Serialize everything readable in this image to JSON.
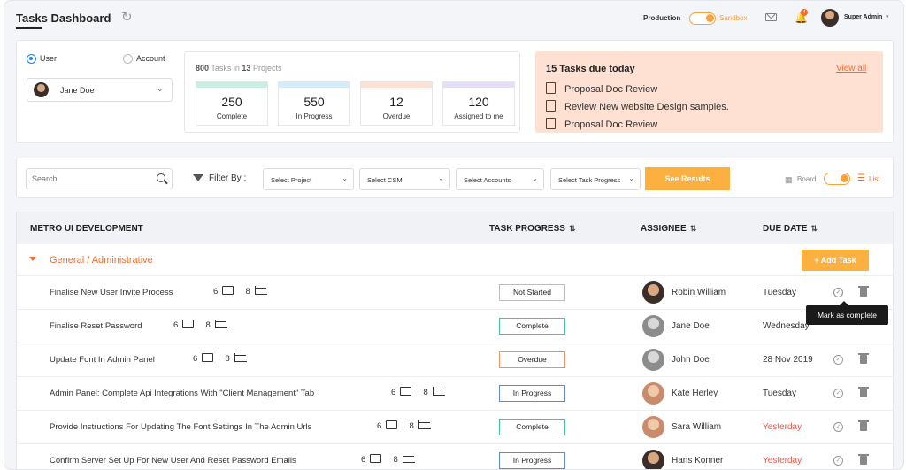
{
  "header": {
    "title": "Tasks Dashboard",
    "env_label": "Production",
    "env_alt": "Sandbox",
    "notifications_count": "4",
    "user_name": "Super Admin"
  },
  "summary": {
    "radio_user": "User",
    "radio_account": "Account",
    "selected_user": "Jane Doe",
    "tasks_total": "800",
    "tasks_word": "Tasks in",
    "projects_total": "13",
    "projects_word": "Projects",
    "stats": [
      {
        "value": "250",
        "label": "Complete",
        "color": "#c6f0e0"
      },
      {
        "value": "550",
        "label": "In Progress",
        "color": "#d3ecfa"
      },
      {
        "value": "12",
        "label": "Overdue",
        "color": "#fde1d5"
      },
      {
        "value": "120",
        "label": "Assigned to me",
        "color": "#e6ddf8"
      }
    ],
    "due_title": "15 Tasks due today",
    "due_view_all": "View all",
    "due_items": [
      "Proposal Doc Review",
      "Review New website Design samples.",
      "Proposal Doc Review"
    ]
  },
  "filters": {
    "search_placeholder": "Search",
    "filter_by": "Filter By :",
    "project": "Select Project",
    "csm": "Select CSM",
    "accounts": "Select Accounts",
    "task_progress": "Select Task Progress",
    "see_results": "See Results",
    "board": "Board",
    "list": "List"
  },
  "table": {
    "project_title": "METRO UI DEVELOPMENT",
    "col_progress": "TASK PROGRESS",
    "col_assignee": "ASSIGNEE",
    "col_due": "DUE DATE",
    "group": "General / Administrative",
    "add_task": "+ Add Task",
    "tooltip": "Mark as complete",
    "rows": [
      {
        "name": "Finalise New User Invite Process",
        "comments": "6",
        "subtasks": "8",
        "status": "Not Started",
        "assignee": "Robin William",
        "due": "Tuesday"
      },
      {
        "name": "Finalise Reset Password",
        "comments": "6",
        "subtasks": "8",
        "status": "Complete",
        "assignee": "Jane Doe",
        "due": "Wednesday"
      },
      {
        "name": "Update Font In Admin Panel",
        "comments": "6",
        "subtasks": "8",
        "status": "Overdue",
        "assignee": "John Doe",
        "due": "28 Nov 2019"
      },
      {
        "name": "Admin Panel: Complete Api Integrations With \"Client Management\" Tab",
        "comments": "6",
        "subtasks": "8",
        "status": "In Progress",
        "assignee": "Kate Herley",
        "due": "Tuesday"
      },
      {
        "name": "Provide Instructions For Updating The Font Settings In The Admin Urls",
        "comments": "6",
        "subtasks": "8",
        "status": "Complete",
        "assignee": "Sara William",
        "due": "Yesterday"
      },
      {
        "name": "Confirm Server Set Up For New User And Reset Password Emails",
        "comments": "6",
        "subtasks": "8",
        "status": "In Progress",
        "assignee": "Hans Konner",
        "due": "Yesterday"
      }
    ]
  },
  "colors": {
    "accent": "#fbb040",
    "orange": "#f46b2b",
    "overdue_text": "#f05b4b"
  }
}
